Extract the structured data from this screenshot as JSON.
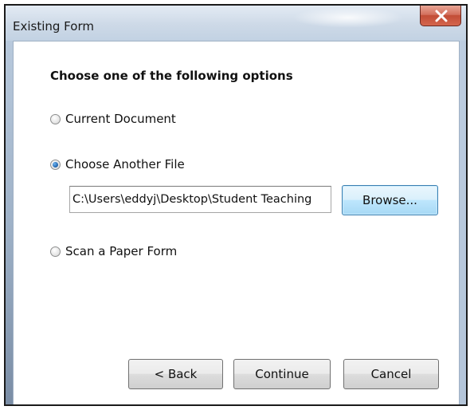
{
  "window": {
    "title": "Existing Form"
  },
  "dialog": {
    "heading": "Choose one of the following options",
    "options": [
      {
        "label": "Current Document",
        "selected": false
      },
      {
        "label": "Choose Another File",
        "selected": true
      },
      {
        "label": "Scan a Paper Form",
        "selected": false
      }
    ],
    "file_path": "C:\\Users\\eddyj\\Desktop\\Student Teaching",
    "browse_label": "Browse...",
    "back_label": "< Back",
    "continue_label": "Continue",
    "cancel_label": "Cancel"
  },
  "icons": {
    "close": "close-icon"
  },
  "colors": {
    "close_button": "#c24d36",
    "default_button_border": "#3c7fb1",
    "radio_selected": "#1d5fa8"
  }
}
